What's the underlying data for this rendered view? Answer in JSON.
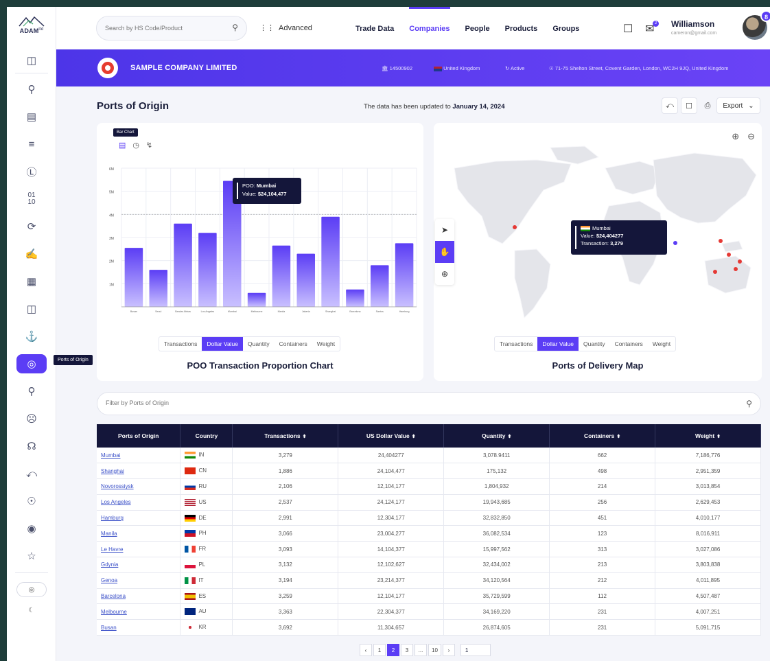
{
  "app": {
    "brand": "ADAM",
    "brand_suffix": "ltd"
  },
  "topbar": {
    "search_placeholder": "Search by HS Code/Product",
    "advanced_label": "Advanced",
    "nav": [
      {
        "label": "Trade Data",
        "active": false
      },
      {
        "label": "Companies",
        "active": true
      },
      {
        "label": "People",
        "active": false
      },
      {
        "label": "Products",
        "active": false
      },
      {
        "label": "Groups",
        "active": false
      }
    ],
    "notif_count": "2",
    "user_name": "Williamson",
    "user_email": "cameron@gmail.com",
    "avatar_badge": "8"
  },
  "sidebar": {
    "active_tooltip": "Ports of Origin"
  },
  "company": {
    "name": "SAMPLE COMPANY LIMITED",
    "id": "14500902",
    "country": "United Kingdom",
    "status": "Active",
    "address": "71-75 Shelton Street, Covent Garden, London, WC2H 9JQ, United Kingdom"
  },
  "page": {
    "title": "Ports of Origin",
    "update_prefix": "The data has been updated to",
    "update_date": "January 14, 2024",
    "export_label": "Export"
  },
  "bar_chart_card": {
    "tooltip_label": "Bar Chart",
    "tabs": [
      "Transactions",
      "Dollar Value",
      "Quantity",
      "Containers",
      "Weight"
    ],
    "active_tab": "Dollar Value",
    "title": "POO Transaction Proportion Chart",
    "hover_label_prefix": "POO:",
    "hover_port": "Mumbai",
    "hover_value_prefix": "Value:",
    "hover_value": "$24,104,477"
  },
  "chart_data": {
    "type": "bar",
    "categories": [
      "Busan",
      "Seoul",
      "Bandar Abbas",
      "Los Angeles",
      "Mumbai",
      "Melbourne",
      "Manila",
      "Jakarta",
      "Shanghai",
      "Barcelona",
      "Santos",
      "Hamburg"
    ],
    "values": [
      2.55,
      1.6,
      3.6,
      3.2,
      5.45,
      0.6,
      2.65,
      2.3,
      3.9,
      0.75,
      1.8,
      2.75
    ],
    "y_ticks": [
      "6M",
      "5M",
      "4M",
      "3M",
      "2M",
      "1M"
    ],
    "ylim": [
      0,
      6
    ],
    "highlight_index": 4,
    "reference_line": 4,
    "grid": true,
    "color": "#5b3df5"
  },
  "map_card": {
    "tabs": [
      "Transactions",
      "Dollar Value",
      "Quantity",
      "Containers",
      "Weight"
    ],
    "active_tab": "Dollar Value",
    "title": "Ports of Delivery Map",
    "tooltip_port": "Mumbai",
    "tooltip_value_label": "Value:",
    "tooltip_value": "$24,404277",
    "tooltip_tx_label": "Transaction:",
    "tooltip_tx": "3,279"
  },
  "filter": {
    "placeholder": "Filter by Ports of Origin"
  },
  "table": {
    "headers": [
      "Ports of Origin",
      "Country",
      "Transactions",
      "US Dollar Value",
      "Quantity",
      "Containers",
      "Weight"
    ],
    "rows": [
      {
        "port": "Mumbai",
        "code": "IN",
        "tx": "3,279",
        "usd": "24,404277",
        "qty": "3,078.9411",
        "cont": "662",
        "weight": "7,186,776"
      },
      {
        "port": "Shanghai",
        "code": "CN",
        "tx": "1,886",
        "usd": "24,104,477",
        "qty": "175,132",
        "cont": "498",
        "weight": "2,951,359"
      },
      {
        "port": "Novorossiysk",
        "code": "RU",
        "tx": "2,106",
        "usd": "12,104,177",
        "qty": "1,804,932",
        "cont": "214",
        "weight": "3,013,854"
      },
      {
        "port": "Los Angeles",
        "code": "US",
        "tx": "2,537",
        "usd": "24,124,177",
        "qty": "19,943,685",
        "cont": "256",
        "weight": "2,629,453"
      },
      {
        "port": "Hamburg",
        "code": "DE",
        "tx": "2,991",
        "usd": "12,304,177",
        "qty": "32,832,850",
        "cont": "451",
        "weight": "4,010,177"
      },
      {
        "port": "Manila",
        "code": "PH",
        "tx": "3,066",
        "usd": "23,004,277",
        "qty": "36,082,534",
        "cont": "123",
        "weight": "8,016,911"
      },
      {
        "port": "Le Havre",
        "code": "FR",
        "tx": "3,093",
        "usd": "14,104,377",
        "qty": "15,997,562",
        "cont": "313",
        "weight": "3,027,086"
      },
      {
        "port": "Gdynia",
        "code": "PL",
        "tx": "3,132",
        "usd": "12,102,627",
        "qty": "32,434,002",
        "cont": "213",
        "weight": "3,803,838"
      },
      {
        "port": "Genoa",
        "code": "IT",
        "tx": "3,194",
        "usd": "23,214,377",
        "qty": "34,120,564",
        "cont": "212",
        "weight": "4,011,895"
      },
      {
        "port": "Barcelona",
        "code": "ES",
        "tx": "3,259",
        "usd": "12,104,177",
        "qty": "35,729,599",
        "cont": "112",
        "weight": "4,507,487"
      },
      {
        "port": "Melbourne",
        "code": "AU",
        "tx": "3,363",
        "usd": "22,304,377",
        "qty": "34,169,220",
        "cont": "231",
        "weight": "4,007,251"
      },
      {
        "port": "Busan",
        "code": "KR",
        "tx": "3,692",
        "usd": "11,304,657",
        "qty": "26,874,605",
        "cont": "231",
        "weight": "5,091,715"
      }
    ]
  },
  "pagination": {
    "pages": [
      "1",
      "2",
      "3",
      "...",
      "10"
    ],
    "active": "2",
    "goto_value": "1"
  }
}
